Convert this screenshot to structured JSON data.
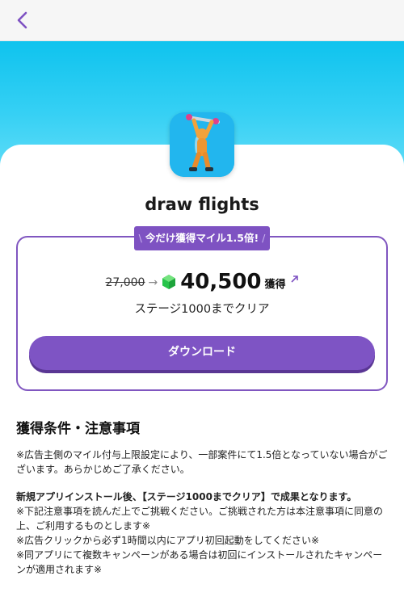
{
  "nav": {
    "back_icon": "chevron-left-icon",
    "accent_color": "#7e52c2"
  },
  "hero": {
    "color": "#14c4ef"
  },
  "app": {
    "name": "draw flights",
    "icon": "draw-flights-app-icon"
  },
  "offer": {
    "promo_label": "今だけ獲得マイル1.5倍!",
    "promo_slash_left": "\\",
    "promo_slash_right": "/",
    "old_amount": "27,000",
    "arrow": "→",
    "currency_icon": "green-gem-icon",
    "new_amount": "40,500",
    "earn_label": "獲得",
    "external_icon": "external-link-icon",
    "condition": "ステージ1000までクリア",
    "download_label": "ダウンロード"
  },
  "terms": {
    "title": "獲得条件・注意事項",
    "note1": "※広告主側のマイル付与上限設定により、一部案件にて1.5倍となっていない場合がございます。あらかじめご了承ください。",
    "condition_line": "新規アプリインストール後、【ステージ1000までクリア】で成果となります。",
    "note2": "※下記注意事項を読んだ上でご挑戦ください。ご挑戦された方は本注意事項に同意の上、ご利用するものとします※",
    "note3": "※広告クリックから必ず1時間以内にアプリ初回起動をしてください※",
    "note4": "※同アプリにて複数キャンペーンがある場合は初回にインストールされたキャンペーンが適用されます※"
  }
}
